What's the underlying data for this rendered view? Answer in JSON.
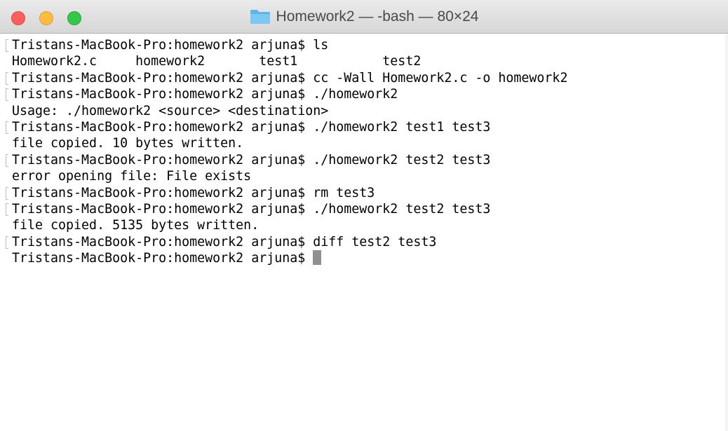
{
  "window": {
    "title": "Homework2 — -bash — 80×24",
    "folder_icon": "folder-icon"
  },
  "terminal": {
    "lines": [
      {
        "text": "Tristans-MacBook-Pro:homework2 arjuna$ ls",
        "kind": "prompt"
      },
      {
        "text": "Homework2.c     homework2       test1           test2",
        "kind": "output"
      },
      {
        "text": "Tristans-MacBook-Pro:homework2 arjuna$ cc -Wall Homework2.c -o homework2",
        "kind": "prompt"
      },
      {
        "text": "Tristans-MacBook-Pro:homework2 arjuna$ ./homework2",
        "kind": "prompt"
      },
      {
        "text": "Usage: ./homework2 <source> <destination>",
        "kind": "output"
      },
      {
        "text": "Tristans-MacBook-Pro:homework2 arjuna$ ./homework2 test1 test3",
        "kind": "prompt"
      },
      {
        "text": "file copied. 10 bytes written.",
        "kind": "output"
      },
      {
        "text": "Tristans-MacBook-Pro:homework2 arjuna$ ./homework2 test2 test3",
        "kind": "prompt"
      },
      {
        "text": "error opening file: File exists",
        "kind": "output"
      },
      {
        "text": "Tristans-MacBook-Pro:homework2 arjuna$ rm test3",
        "kind": "prompt"
      },
      {
        "text": "Tristans-MacBook-Pro:homework2 arjuna$ ./homework2 test2 test3",
        "kind": "prompt"
      },
      {
        "text": "file copied. 5135 bytes written.",
        "kind": "output"
      },
      {
        "text": "Tristans-MacBook-Pro:homework2 arjuna$ diff test2 test3",
        "kind": "prompt"
      },
      {
        "text": "Tristans-MacBook-Pro:homework2 arjuna$ ",
        "kind": "current"
      }
    ]
  }
}
